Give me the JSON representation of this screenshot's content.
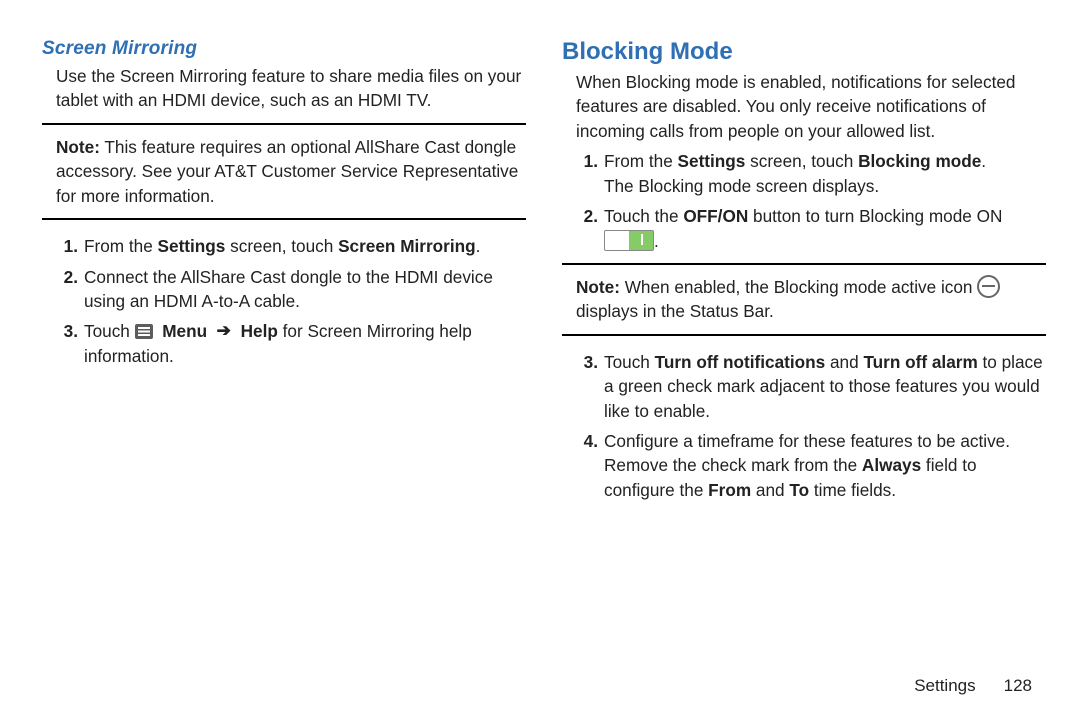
{
  "left": {
    "subheading": "Screen Mirroring",
    "intro": "Use the Screen Mirroring feature to share media files on your tablet with an HDMI device, such as an HDMI TV.",
    "noteLabel": "Note:",
    "noteBody": " This feature requires an optional AllShare Cast dongle accessory. See your AT&T Customer Service Representative for more information.",
    "steps": {
      "s1a": "From the ",
      "s1b": "Settings",
      "s1c": " screen, touch ",
      "s1d": "Screen Mirroring",
      "s1e": ".",
      "s2": "Connect the AllShare Cast dongle to the HDMI device using an HDMI A-to-A cable.",
      "s3a": "Touch ",
      "s3b": "Menu",
      "s3c": "Help",
      "s3d": " for Screen Mirroring help information."
    }
  },
  "right": {
    "heading": "Blocking Mode",
    "intro": "When Blocking mode is enabled, notifications for selected features are disabled. You only receive notifications of incoming calls from people on your allowed list.",
    "steps": {
      "s1a": "From the ",
      "s1b": "Settings",
      "s1c": " screen, touch ",
      "s1d": "Blocking mode",
      "s1e": ".",
      "s1f": "The Blocking mode screen displays.",
      "s2a": "Touch the ",
      "s2b": "OFF/ON",
      "s2c": " button to turn Blocking mode ON ",
      "s2d": ".",
      "s3a": "Touch ",
      "s3b": "Turn off notifications",
      "s3c": " and ",
      "s3d": "Turn off alarm",
      "s3e": " to place a green check mark adjacent to those features you would like to enable.",
      "s4a": "Configure a timeframe for these features to be active. Remove the check mark from the ",
      "s4b": "Always",
      "s4c": " field to configure the ",
      "s4d": "From",
      "s4e": " and ",
      "s4f": "To",
      "s4g": " time fields."
    },
    "noteLabel": "Note:",
    "noteBody1": " When enabled, the Blocking mode active icon ",
    "noteBody2": " displays in the Status Bar."
  },
  "footer": {
    "section": "Settings",
    "page": "128"
  },
  "nums": {
    "n1": "1.",
    "n2": "2.",
    "n3": "3.",
    "n4": "4."
  },
  "arrow": "➔"
}
